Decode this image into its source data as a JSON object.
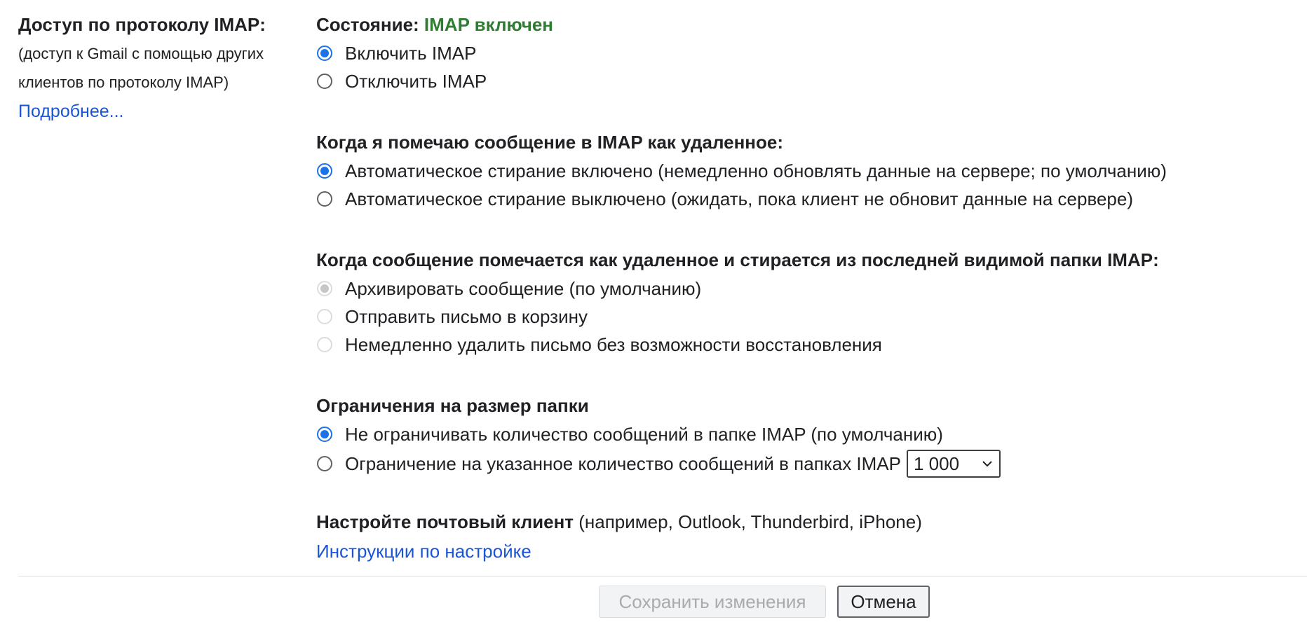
{
  "left": {
    "title": "Доступ по протоколу IMAP:",
    "desc_line1": "(доступ к Gmail с помощью других",
    "desc_line2": "клиентов по протоколу IMAP)",
    "learn_more": "Подробнее..."
  },
  "status": {
    "label": "Состояние:",
    "value": "IMAP включен",
    "value_color": "#2e7d32"
  },
  "imap_toggle": {
    "options": [
      {
        "label": "Включить IMAP",
        "checked": true
      },
      {
        "label": "Отключить IMAP",
        "checked": false
      }
    ]
  },
  "expunge": {
    "heading": "Когда я помечаю сообщение в IMAP как удаленное:",
    "options": [
      {
        "label": "Автоматическое стирание включено (немедленно обновлять данные на сервере; по умолчанию)",
        "checked": true
      },
      {
        "label": "Автоматическое стирание выключено (ожидать, пока клиент не обновит данные на сервере)",
        "checked": false
      }
    ]
  },
  "deleted_action": {
    "heading": "Когда сообщение помечается как удаленное и стирается из последней видимой папки IMAP:",
    "options": [
      {
        "label": "Архивировать сообщение (по умолчанию)",
        "checked": true,
        "disabled": true
      },
      {
        "label": "Отправить письмо в корзину",
        "checked": false,
        "disabled": true
      },
      {
        "label": "Немедленно удалить письмо без возможности восстановления",
        "checked": false,
        "disabled": true
      }
    ]
  },
  "folder_limits": {
    "heading": "Ограничения на размер папки",
    "options": [
      {
        "label": "Не ограничивать количество сообщений в папке IMAP (по умолчанию)",
        "checked": true
      },
      {
        "label": "Ограничение на указанное количество сообщений в папках IMAP",
        "checked": false
      }
    ],
    "limit_value": "1 000"
  },
  "client": {
    "bold": "Настройте почтовый клиент",
    "rest": " (например, Outlook, Thunderbird, iPhone)",
    "instructions_link": "Инструкции по настройке"
  },
  "buttons": {
    "save": "Сохранить изменения",
    "cancel": "Отмена"
  },
  "colors": {
    "link": "#1a55d4",
    "radio_active": "#1a73e8"
  }
}
